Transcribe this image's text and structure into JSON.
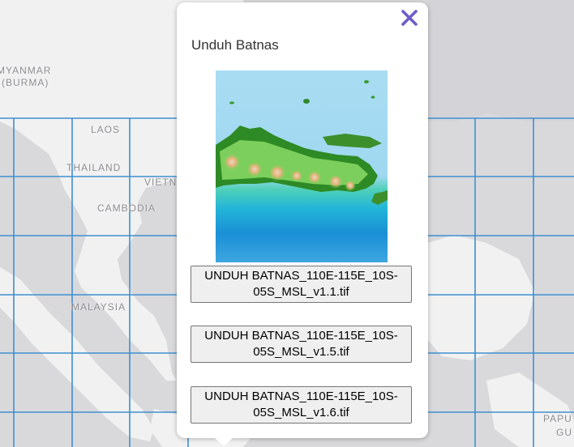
{
  "map": {
    "background": "#d9d9dc",
    "land_color": "#f1f1f1",
    "grid_color": "#3f8fd0",
    "labels": {
      "myanmar": "MYANMAR",
      "burma": "(BURMA)",
      "laos": "LAOS",
      "thailand": "THAILAND",
      "vietnam": "VIETN",
      "cambodia": "CAMBODIA",
      "malaysia": "MALAYSIA",
      "papua": "PAPU",
      "papua2": "GU"
    }
  },
  "popup": {
    "title": "Unduh Batnas",
    "close_icon": "close-x-icon",
    "close_color": "#6e5cc7",
    "preview_alt": "Batnas elevation preview",
    "buttons": [
      {
        "label": "UNDUH BATNAS_110E-115E_10S-05S_MSL_v1.1.tif"
      },
      {
        "label": "UNDUH BATNAS_110E-115E_10S-05S_MSL_v1.5.tif"
      },
      {
        "label": "UNDUH BATNAS_110E-115E_10S-05S_MSL_v1.6.tif"
      }
    ]
  }
}
